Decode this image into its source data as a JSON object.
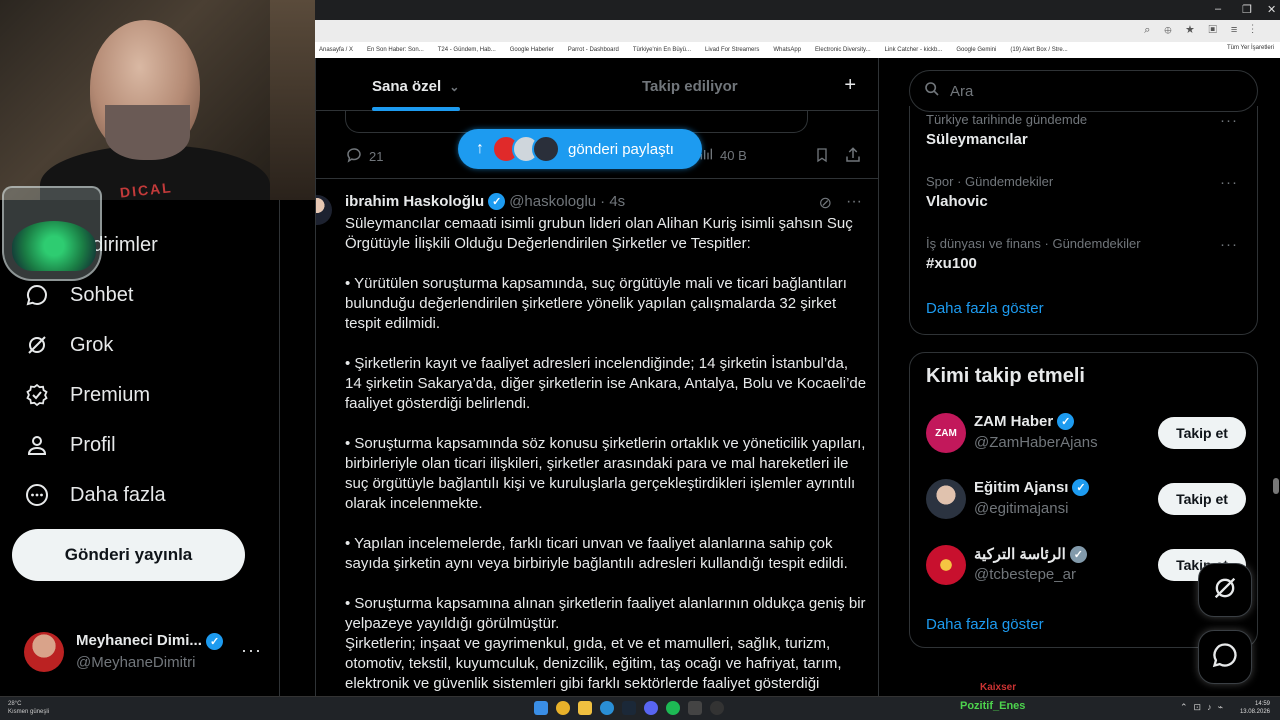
{
  "chrome": {
    "bookmarks": [
      "Anasayfa / X",
      "En Son Haber: Son...",
      "T24 - Gündem, Hab...",
      "Google Haberler",
      "Parrot - Dashboard",
      "Türkiye'nin En Büyü...",
      "Livad For Streamers",
      "WhatsApp",
      "Electronic Diversity...",
      "Link Catcher - kickb...",
      "Google Gemini",
      "(19) Alert Box / Stre..."
    ],
    "all_bookmarks": "Tüm Yer İşaretleri",
    "win_controls": [
      "–",
      "❐",
      "✕"
    ]
  },
  "nav": {
    "items": [
      {
        "label": "Bildirimler",
        "icon": "bell-icon"
      },
      {
        "label": "Sohbet",
        "icon": "chat-icon"
      },
      {
        "label": "Grok",
        "icon": "grok-icon"
      },
      {
        "label": "Premium",
        "icon": "premium-icon"
      },
      {
        "label": "Profil",
        "icon": "profile-icon"
      },
      {
        "label": "Daha fazla",
        "icon": "more-circle-icon"
      }
    ],
    "post_button": "Gönderi yayınla",
    "account": {
      "name": "Meyhaneci Dimi...",
      "handle": "@MeyhaneDimitri",
      "more": "···"
    }
  },
  "webcam": {
    "shirt_text": "DICAL  YSE"
  },
  "feed": {
    "tabs": [
      {
        "label": "Sana özel",
        "icon": "chevron-down-icon"
      },
      {
        "label": "Takip ediliyor"
      }
    ],
    "plus": "+",
    "prev_actions": {
      "replies": "21",
      "views": "40 B"
    },
    "new_posts_pill": "gönderi paylaştı",
    "tweet": {
      "name": "ibrahim Haskoloğlu",
      "handle": "@haskologlu",
      "time": "· 4s",
      "text": "Süleymancılar cemaati isimli grubun lideri olan Alihan Kuriş isimli şahsın Suç Örgütüyle İlişkili Olduğu Değerlendirilen Şirketler ve Tespitler:\n\n• Yürütülen soruşturma kapsamında, suç örgütüyle mali ve ticari bağlantıları bulunduğu değerlendirilen şirketlere yönelik yapılan çalışmalarda 32 şirket tespit edilmidi.\n\n• Şirketlerin kayıt ve faaliyet adresleri incelendiğinde; 14 şirketin İstanbul’da, 14 şirketin Sakarya’da, diğer şirketlerin ise Ankara, Antalya, Bolu ve Kocaeli’de faaliyet gösterdiği belirlendi.\n\n• Soruşturma kapsamında söz konusu şirketlerin ortaklık ve yöneticilik yapıları, birbirleriyle olan ticari ilişkileri, şirketler arasındaki para ve mal hareketleri ile suç örgütüyle bağlantılı kişi ve kuruluşlarla gerçekleştirdikleri işlemler ayrıntılı olarak incelenmekte.\n\n• Yapılan incelemelerde, farklı ticari unvan ve faaliyet alanlarına sahip çok sayıda şirketin aynı veya birbiriyle bağlantılı adresleri kullandığı tespit edildi.\n\n• Soruşturma kapsamına alınan şirketlerin faaliyet alanlarının oldukça geniş bir yelpazeye yayıldığı görülmüştür.\nŞirketlerin; inşaat ve gayrimenkul, gıda, et ve et mamulleri, sağlık, turizm, otomotiv, tekstil, kuyumculuk, denizcilik, eğitim, taş ocağı ve hafriyat, tarım, elektronik ve güvenlik sistemleri gibi farklı sektörlerde faaliyet gösterdiği"
    }
  },
  "sidebar": {
    "search_placeholder": "Ara",
    "trends": [
      {
        "category": "Türkiye tarihinde gündemde",
        "name": "Süleymancılar"
      },
      {
        "category": "Spor · Gündemdekiler",
        "name": "Vlahovic"
      },
      {
        "category": "İş dünyası ve finans · Gündemdekiler",
        "name": "#xu100"
      }
    ],
    "show_more": "Daha fazla göster",
    "follow_title": "Kimi takip etmeli",
    "suggestions": [
      {
        "name": "ZAM Haber",
        "handle": "@ZamHaberAjans",
        "button": "Takip et",
        "avatar_text": "ZAM"
      },
      {
        "name": "Eğitim Ajansı",
        "handle": "@egitimajansi",
        "button": "Takip et"
      },
      {
        "name": "الرئاسة التركية",
        "handle": "@tcbestepe_ar",
        "button": "Takip et"
      }
    ],
    "show_more_2": "Daha fazla göster",
    "footer_peek": "Kaixser"
  },
  "taskbar": {
    "weather_temp": "28°C",
    "weather_desc": "Kısmen güneşli",
    "user": "Pozitif_Enes",
    "time": "14:59",
    "date": "13.08.2026"
  },
  "colors": {
    "accent": "#1d9bf0",
    "background": "#000000",
    "text": "#e7e9ea",
    "muted": "#71767b"
  }
}
